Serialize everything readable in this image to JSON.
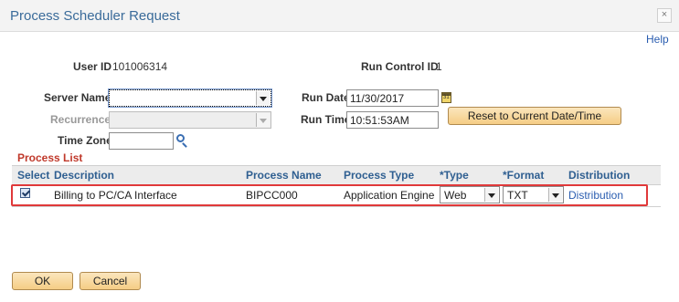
{
  "dialog": {
    "title": "Process Scheduler Request",
    "close_glyph": "×",
    "help_label": "Help"
  },
  "form": {
    "user_id_label": "User ID",
    "user_id_value": "101006314",
    "run_control_id_label": "Run Control ID",
    "run_control_id_value": "1",
    "server_name_label": "Server Name",
    "server_name_value": "",
    "recurrence_label": "Recurrence",
    "recurrence_value": "",
    "time_zone_label": "Time Zone",
    "time_zone_value": "",
    "run_date_label": "Run Date",
    "run_date_value": "11/30/2017",
    "run_time_label": "Run Time",
    "run_time_value": "10:51:53AM",
    "reset_button_label": "Reset to Current Date/Time"
  },
  "process_list": {
    "title": "Process List",
    "columns": [
      "Select",
      "Description",
      "Process Name",
      "Process Type",
      "*Type",
      "*Format",
      "Distribution"
    ],
    "rows": [
      {
        "selected": true,
        "description": "Billing to PC/CA Interface",
        "process_name": "BIPCC000",
        "process_type": "Application Engine",
        "type": "Web",
        "format": "TXT",
        "distribution": "Distribution"
      }
    ]
  },
  "footer": {
    "ok_label": "OK",
    "cancel_label": "Cancel"
  },
  "colors": {
    "title": "#3a6b9a",
    "link": "#2a5db0",
    "section_title": "#c0392b",
    "row_highlight": "#e0393a",
    "button_bg": "#f5cd85"
  }
}
